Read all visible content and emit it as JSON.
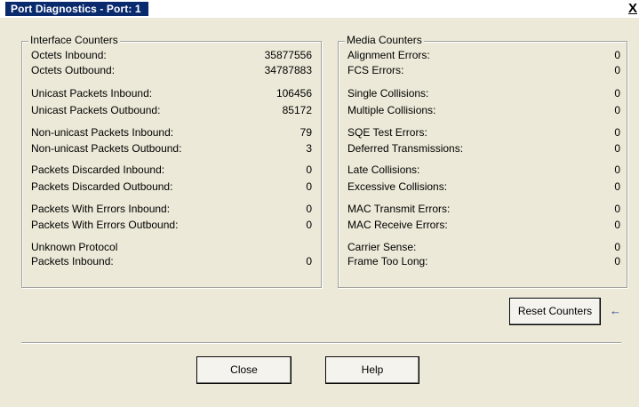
{
  "window": {
    "title": "Port Diagnostics - Port: 1",
    "close_glyph": "X"
  },
  "interface_counters": {
    "legend": "Interface Counters",
    "rows": [
      {
        "label": "Octets Inbound:",
        "value": "35877556"
      },
      {
        "label": "Octets Outbound:",
        "value": "34787883"
      },
      {
        "label": "Unicast Packets Inbound:",
        "value": "106456"
      },
      {
        "label": "Unicast Packets Outbound:",
        "value": "85172"
      },
      {
        "label": "Non-unicast Packets Inbound:",
        "value": "79"
      },
      {
        "label": "Non-unicast Packets Outbound:",
        "value": "3"
      },
      {
        "label": "Packets Discarded Inbound:",
        "value": "0"
      },
      {
        "label": "Packets Discarded Outbound:",
        "value": "0"
      },
      {
        "label": "Packets With Errors Inbound:",
        "value": "0"
      },
      {
        "label": "Packets With Errors Outbound:",
        "value": "0"
      },
      {
        "label": "Unknown Protocol",
        "value": ""
      },
      {
        "label": "Packets Inbound:",
        "value": "0"
      }
    ]
  },
  "media_counters": {
    "legend": "Media Counters",
    "rows": [
      {
        "label": "Alignment Errors:",
        "value": "0"
      },
      {
        "label": "FCS Errors:",
        "value": "0"
      },
      {
        "label": "Single Collisions:",
        "value": "0"
      },
      {
        "label": "Multiple Collisions:",
        "value": "0"
      },
      {
        "label": "SQE Test Errors:",
        "value": "0"
      },
      {
        "label": "Deferred Transmissions:",
        "value": "0"
      },
      {
        "label": "Late Collisions:",
        "value": "0"
      },
      {
        "label": "Excessive Collisions:",
        "value": "0"
      },
      {
        "label": "MAC Transmit Errors:",
        "value": "0"
      },
      {
        "label": "MAC Receive Errors:",
        "value": "0"
      },
      {
        "label": "Carrier Sense:",
        "value": "0"
      },
      {
        "label": "Frame Too Long:",
        "value": "0"
      }
    ]
  },
  "buttons": {
    "reset": "Reset Counters",
    "close": "Close",
    "help": "Help"
  },
  "annotation": {
    "arrow_glyph": "←",
    "arrow_color": "#1f3a8a"
  },
  "colors": {
    "title_bar": "#0a2a6e",
    "dialog_bg": "#ece9d8"
  }
}
